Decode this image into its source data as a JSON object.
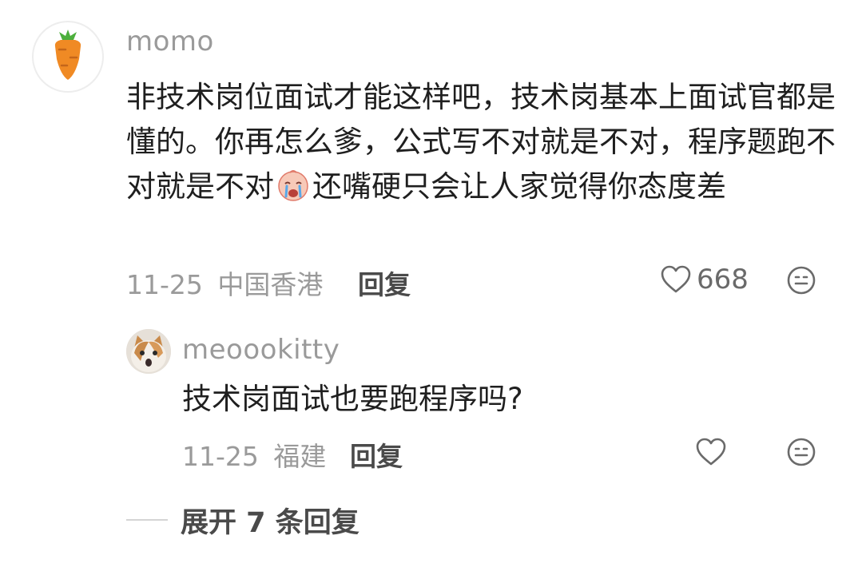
{
  "comment": {
    "username": "momo",
    "avatar_icon": "carrot-icon",
    "text_before_emoji": "非技术岗位面试才能这样吧，技术岗基本上面试官都是懂的。你再怎么爹，公式写不对就是不对，程序题跑不对就是不对",
    "inline_emoji": "crying-face-emoji",
    "text_after_emoji": "还嘴硬只会让人家觉得你态度差",
    "date": "11-25",
    "location": "中国香港",
    "reply_label": "回复",
    "like_count": "668"
  },
  "reply": {
    "username": "meoookitty",
    "avatar_icon": "cat-avatar",
    "text": "技术岗面试也要跑程序吗?",
    "date": "11-25",
    "location": "福建",
    "reply_label": "回复"
  },
  "expand_label": "展开 7 条回复",
  "colors": {
    "meta_gray": "#9a9a9a",
    "text_dark": "#1f1f1f",
    "carrot_orange": "#f08a24",
    "carrot_green": "#4caf3c"
  }
}
